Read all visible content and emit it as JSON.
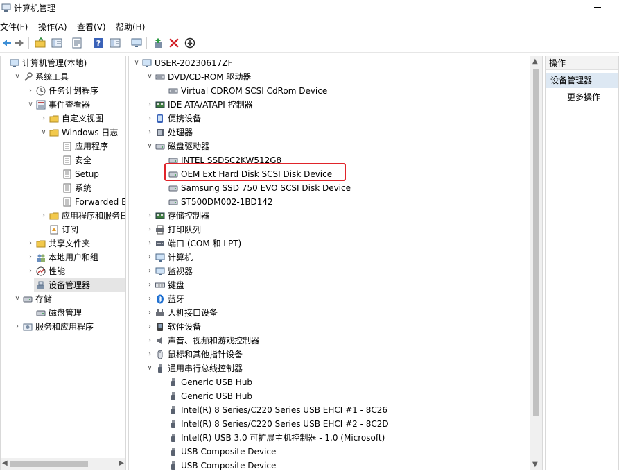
{
  "window": {
    "title": "计算机管理"
  },
  "menu": [
    "文件(F)",
    "操作(A)",
    "查看(V)",
    "帮助(H)"
  ],
  "toolbar_icons": [
    "back-arrow-icon",
    "forward-arrow-icon",
    "up-folder-icon",
    "show-hide-tree-icon",
    "properties-icon",
    "help-icon",
    "help-topics-icon",
    "monitor-icon",
    "update-driver-icon",
    "uninstall-icon",
    "disable-device-icon"
  ],
  "left_tree": [
    {
      "label": "计算机管理(本地)",
      "level": 0,
      "expander": "",
      "icon": "computer-management-icon"
    },
    {
      "label": "系统工具",
      "level": 1,
      "expander": "v",
      "icon": "system-tools-icon"
    },
    {
      "label": "任务计划程序",
      "level": 2,
      "expander": ">",
      "icon": "clock-icon"
    },
    {
      "label": "事件查看器",
      "level": 2,
      "expander": "v",
      "icon": "event-viewer-icon"
    },
    {
      "label": "自定义视图",
      "level": 3,
      "expander": ">",
      "icon": "folder-icon"
    },
    {
      "label": "Windows 日志",
      "level": 3,
      "expander": "v",
      "icon": "folder-icon"
    },
    {
      "label": "应用程序",
      "level": 4,
      "expander": "",
      "icon": "log-icon"
    },
    {
      "label": "安全",
      "level": 4,
      "expander": "",
      "icon": "log-icon"
    },
    {
      "label": "Setup",
      "level": 4,
      "expander": "",
      "icon": "log-icon"
    },
    {
      "label": "系统",
      "level": 4,
      "expander": "",
      "icon": "log-icon"
    },
    {
      "label": "Forwarded Eve",
      "level": 4,
      "expander": "",
      "icon": "log-icon"
    },
    {
      "label": "应用程序和服务日志",
      "level": 3,
      "expander": ">",
      "icon": "folder-icon"
    },
    {
      "label": "订阅",
      "level": 3,
      "expander": "",
      "icon": "subscription-icon"
    },
    {
      "label": "共享文件夹",
      "level": 2,
      "expander": ">",
      "icon": "shared-folder-icon"
    },
    {
      "label": "本地用户和组",
      "level": 2,
      "expander": ">",
      "icon": "users-icon"
    },
    {
      "label": "性能",
      "level": 2,
      "expander": ">",
      "icon": "performance-icon"
    },
    {
      "label": "设备管理器",
      "level": 2,
      "expander": "",
      "icon": "device-manager-icon",
      "selected": true
    },
    {
      "label": "存储",
      "level": 1,
      "expander": "v",
      "icon": "storage-icon"
    },
    {
      "label": "磁盘管理",
      "level": 2,
      "expander": "",
      "icon": "disk-management-icon"
    },
    {
      "label": "服务和应用程序",
      "level": 1,
      "expander": ">",
      "icon": "services-icon"
    }
  ],
  "device_tree": [
    {
      "label": "USER-20230617ZF",
      "level": 0,
      "expander": "v",
      "icon": "computer-icon"
    },
    {
      "label": "DVD/CD-ROM 驱动器",
      "level": 1,
      "expander": "v",
      "icon": "cdrom-icon"
    },
    {
      "label": "Virtual CDROM SCSI CdRom Device",
      "level": 2,
      "expander": "",
      "icon": "cdrom-icon"
    },
    {
      "label": "IDE ATA/ATAPI 控制器",
      "level": 1,
      "expander": ">",
      "icon": "ide-controller-icon"
    },
    {
      "label": "便携设备",
      "level": 1,
      "expander": ">",
      "icon": "portable-device-icon"
    },
    {
      "label": "处理器",
      "level": 1,
      "expander": ">",
      "icon": "processor-icon"
    },
    {
      "label": "磁盘驱动器",
      "level": 1,
      "expander": "v",
      "icon": "disk-drive-icon"
    },
    {
      "label": "INTEL SSDSC2KW512G8",
      "level": 2,
      "expander": "",
      "icon": "disk-drive-icon"
    },
    {
      "label": "OEM  Ext Hard Disk SCSI Disk Device",
      "level": 2,
      "expander": "",
      "icon": "disk-drive-icon",
      "highlighted": true
    },
    {
      "label": "Samsung SSD 750 EVO SCSI Disk Device",
      "level": 2,
      "expander": "",
      "icon": "disk-drive-icon"
    },
    {
      "label": "ST500DM002-1BD142",
      "level": 2,
      "expander": "",
      "icon": "disk-drive-icon"
    },
    {
      "label": "存储控制器",
      "level": 1,
      "expander": ">",
      "icon": "storage-controller-icon"
    },
    {
      "label": "打印队列",
      "level": 1,
      "expander": ">",
      "icon": "printer-icon"
    },
    {
      "label": "端口 (COM 和 LPT)",
      "level": 1,
      "expander": ">",
      "icon": "port-icon"
    },
    {
      "label": "计算机",
      "level": 1,
      "expander": ">",
      "icon": "monitor-icon"
    },
    {
      "label": "监视器",
      "level": 1,
      "expander": ">",
      "icon": "monitor-icon"
    },
    {
      "label": "键盘",
      "level": 1,
      "expander": ">",
      "icon": "keyboard-icon"
    },
    {
      "label": "蓝牙",
      "level": 1,
      "expander": ">",
      "icon": "bluetooth-icon"
    },
    {
      "label": "人机接口设备",
      "level": 1,
      "expander": ">",
      "icon": "hid-icon"
    },
    {
      "label": "软件设备",
      "level": 1,
      "expander": ">",
      "icon": "software-device-icon"
    },
    {
      "label": "声音、视频和游戏控制器",
      "level": 1,
      "expander": ">",
      "icon": "speaker-icon"
    },
    {
      "label": "鼠标和其他指针设备",
      "level": 1,
      "expander": ">",
      "icon": "mouse-icon"
    },
    {
      "label": "通用串行总线控制器",
      "level": 1,
      "expander": "v",
      "icon": "usb-icon"
    },
    {
      "label": "Generic USB Hub",
      "level": 2,
      "expander": "",
      "icon": "usb-icon"
    },
    {
      "label": "Generic USB Hub",
      "level": 2,
      "expander": "",
      "icon": "usb-icon"
    },
    {
      "label": "Intel(R) 8 Series/C220 Series USB EHCI #1 - 8C26",
      "level": 2,
      "expander": "",
      "icon": "usb-icon"
    },
    {
      "label": "Intel(R) 8 Series/C220 Series USB EHCI #2 - 8C2D",
      "level": 2,
      "expander": "",
      "icon": "usb-icon"
    },
    {
      "label": "Intel(R) USB 3.0 可扩展主机控制器 - 1.0 (Microsoft)",
      "level": 2,
      "expander": "",
      "icon": "usb-icon"
    },
    {
      "label": "USB Composite Device",
      "level": 2,
      "expander": "",
      "icon": "usb-icon"
    },
    {
      "label": "USB Composite Device",
      "level": 2,
      "expander": "",
      "icon": "usb-icon"
    }
  ],
  "actions": {
    "header": "操作",
    "section": "设备管理器",
    "more": "更多操作"
  }
}
